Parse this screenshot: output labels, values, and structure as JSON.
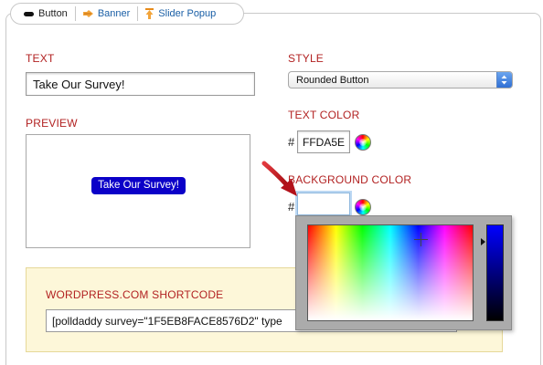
{
  "tabs": [
    {
      "label": "Button",
      "icon": "rounded-button-icon",
      "active": true
    },
    {
      "label": "Banner",
      "icon": "banner-icon",
      "active": false
    },
    {
      "label": "Slider Popup",
      "icon": "slider-popup-icon",
      "active": false
    }
  ],
  "text_section": {
    "label": "TEXT",
    "value": "Take Our Survey!"
  },
  "style_section": {
    "label": "STYLE",
    "selected": "Rounded Button"
  },
  "preview_section": {
    "label": "PREVIEW",
    "button_text": "Take Our Survey!"
  },
  "text_color": {
    "label": "TEXT COLOR",
    "hash": "#",
    "value": "FFDA5E"
  },
  "background_color": {
    "label": "BACKGROUND COLOR",
    "hash": "#",
    "value": ""
  },
  "shortcode": {
    "label": "WORDPRESS.COM SHORTCODE",
    "value": "[polldaddy survey=\"1F5EB8FACE8576D2\" type"
  },
  "colors": {
    "label_red": "#b22222",
    "tab_link": "#1a5fa6",
    "preview_button_bg": "#0b00c8",
    "preview_button_text": "#ffffff",
    "shortcode_bg": "#fdf7d9",
    "annotation_arrow": "#c0141a"
  }
}
